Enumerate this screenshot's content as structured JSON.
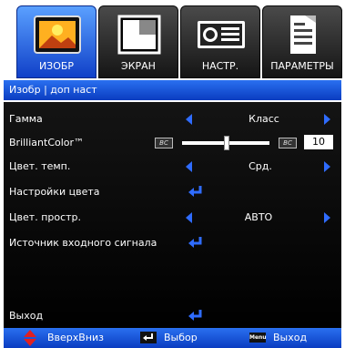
{
  "tabs": [
    {
      "label": "ИЗОБР",
      "icon": "image-icon",
      "active": true
    },
    {
      "label": "ЭКРАН",
      "icon": "screen-icon",
      "active": false
    },
    {
      "label": "НАСТР.",
      "icon": "projector-icon",
      "active": false
    },
    {
      "label": "ПАРАМЕТРЫ",
      "icon": "options-icon",
      "active": false
    }
  ],
  "title": "Изобр | доп наст",
  "rows": {
    "gamma": {
      "label": "Гамма",
      "value": "Класс"
    },
    "brilliant": {
      "label": "BrilliantColor™",
      "badge": "BC",
      "value": "10",
      "level": 0.5
    },
    "color_temp": {
      "label": "Цвет. темп.",
      "value": "Срд."
    },
    "color_settings": {
      "label": "Настройки цвета"
    },
    "color_space": {
      "label": "Цвет. простр.",
      "value": "АВТО"
    },
    "input_source": {
      "label": "Источник входного сигнала"
    },
    "exit": {
      "label": "Выход"
    }
  },
  "footer": {
    "updown": "ВверхВниз",
    "select": "Выбор",
    "menu_badge": "Menu",
    "exit": "Выход"
  },
  "colors": {
    "accent": "#2f6cff",
    "bar": "#1d54d8"
  }
}
